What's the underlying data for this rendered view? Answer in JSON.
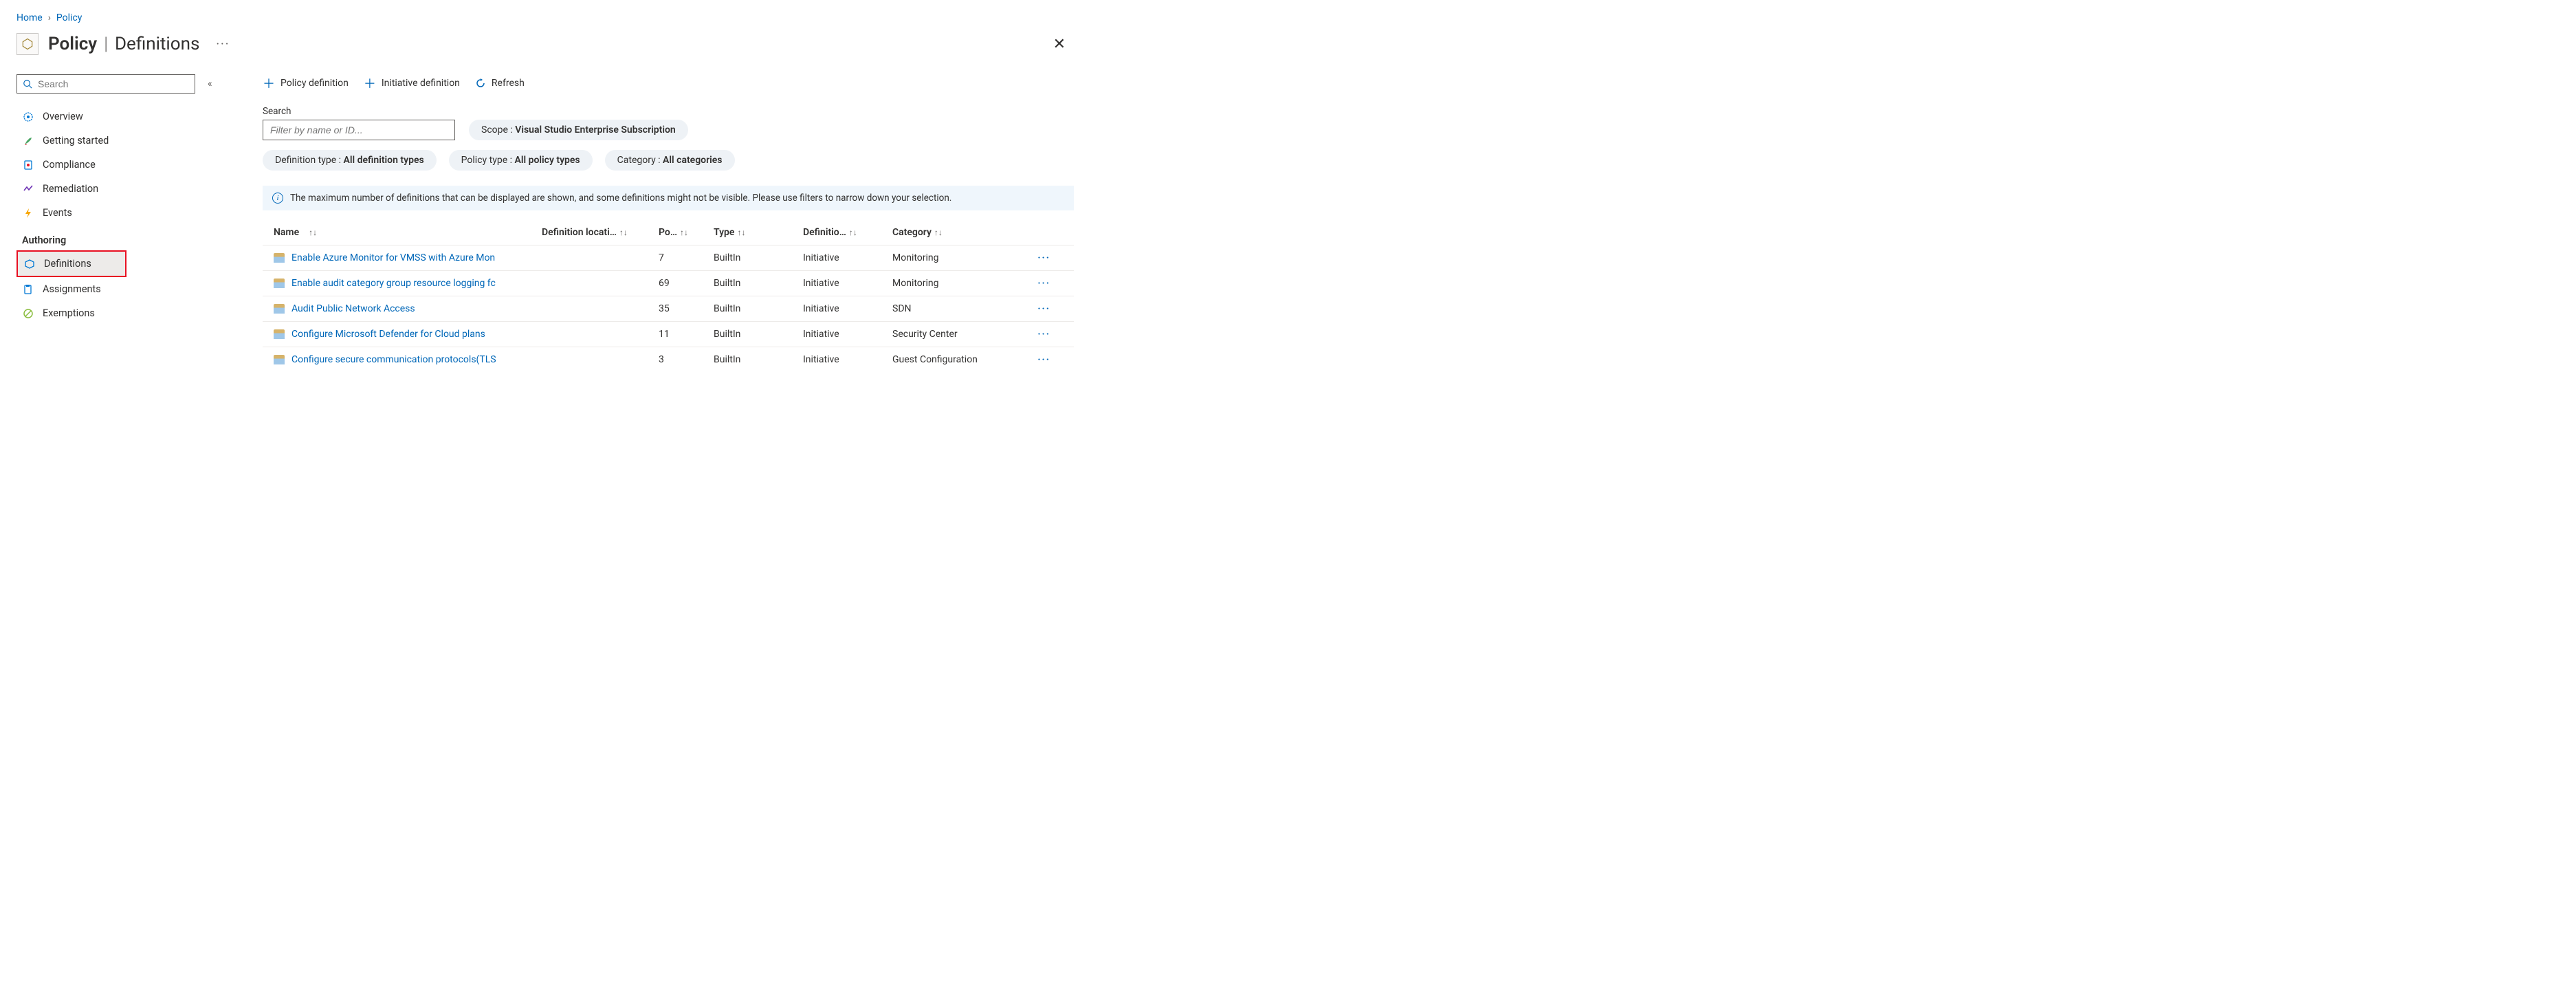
{
  "breadcrumb": {
    "home": "Home",
    "policy": "Policy"
  },
  "header": {
    "strong": "Policy",
    "light": "Definitions"
  },
  "sidebar": {
    "search_placeholder": "Search",
    "items": [
      {
        "label": "Overview"
      },
      {
        "label": "Getting started"
      },
      {
        "label": "Compliance"
      },
      {
        "label": "Remediation"
      },
      {
        "label": "Events"
      }
    ],
    "section": "Authoring",
    "authoring": [
      {
        "label": "Definitions"
      },
      {
        "label": "Assignments"
      },
      {
        "label": "Exemptions"
      }
    ]
  },
  "toolbar": {
    "policy_def": "Policy definition",
    "initiative_def": "Initiative definition",
    "refresh": "Refresh"
  },
  "filters": {
    "search_label": "Search",
    "search_placeholder": "Filter by name or ID...",
    "scope_key": "Scope : ",
    "scope_val": "Visual Studio Enterprise Subscription",
    "deftype_key": "Definition type : ",
    "deftype_val": "All definition types",
    "poltype_key": "Policy type : ",
    "poltype_val": "All policy types",
    "cat_key": "Category : ",
    "cat_val": "All categories"
  },
  "banner": "The maximum number of definitions that can be displayed are shown, and some definitions might not be visible. Please use filters to narrow down your selection.",
  "columns": {
    "name": "Name",
    "loc": "Definition locati…",
    "pol": "Po…",
    "type": "Type",
    "def": "Definitio…",
    "cat": "Category"
  },
  "rows": [
    {
      "name": "Enable Azure Monitor for VMSS with Azure Mon",
      "policies": "7",
      "type": "BuiltIn",
      "def": "Initiative",
      "cat": "Monitoring"
    },
    {
      "name": "Enable audit category group resource logging fc",
      "policies": "69",
      "type": "BuiltIn",
      "def": "Initiative",
      "cat": "Monitoring"
    },
    {
      "name": "Audit Public Network Access",
      "policies": "35",
      "type": "BuiltIn",
      "def": "Initiative",
      "cat": "SDN"
    },
    {
      "name": "Configure Microsoft Defender for Cloud plans",
      "policies": "11",
      "type": "BuiltIn",
      "def": "Initiative",
      "cat": "Security Center"
    },
    {
      "name": "Configure secure communication protocols(TLS",
      "policies": "3",
      "type": "BuiltIn",
      "def": "Initiative",
      "cat": "Guest Configuration"
    }
  ]
}
